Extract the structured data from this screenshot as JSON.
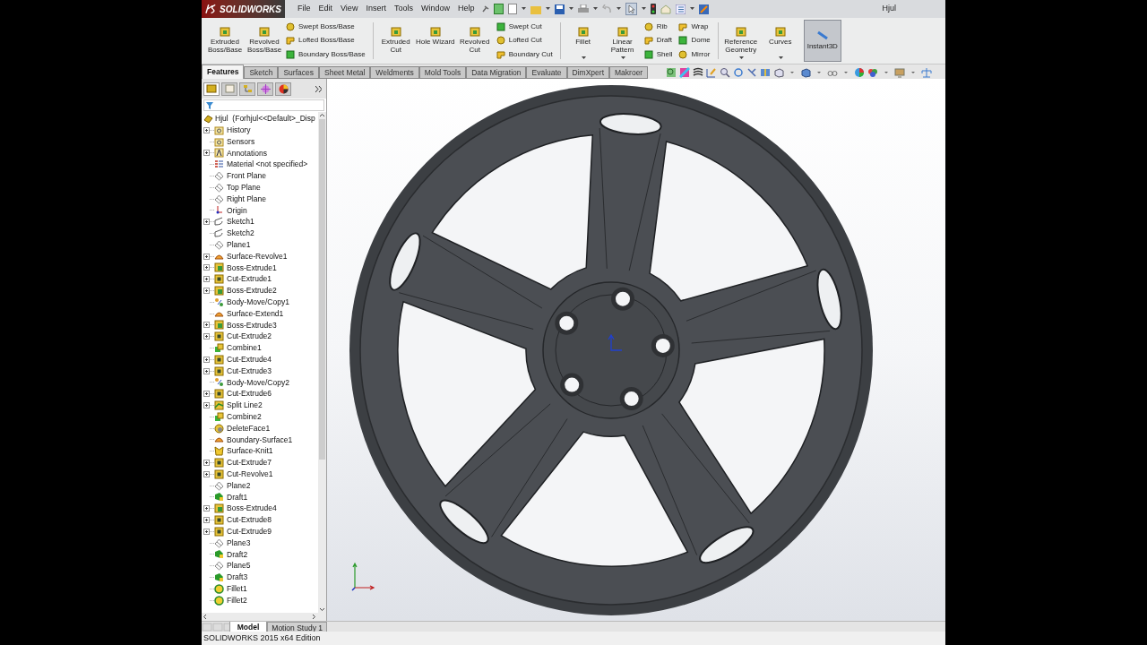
{
  "window": {
    "logo": "SOLIDWORKS",
    "title": "Hjul"
  },
  "menu": [
    "File",
    "Edit",
    "View",
    "Insert",
    "Tools",
    "Window",
    "Help"
  ],
  "ribbon": {
    "columns": [
      {
        "kind": "large",
        "label": "Extruded Boss/Base",
        "dropdown": false
      },
      {
        "kind": "large",
        "label": "Revolved Boss/Base",
        "dropdown": false
      },
      {
        "kind": "stack",
        "items": [
          "Swept Boss/Base",
          "Lofted Boss/Base",
          "Boundary Boss/Base"
        ]
      },
      {
        "kind": "separator"
      },
      {
        "kind": "large",
        "label": "Extruded Cut",
        "dropdown": false
      },
      {
        "kind": "large",
        "label": "Hole Wizard",
        "dropdown": false
      },
      {
        "kind": "large",
        "label": "Revolved Cut",
        "dropdown": false
      },
      {
        "kind": "stack",
        "items": [
          "Swept Cut",
          "Lofted Cut",
          "Boundary Cut"
        ]
      },
      {
        "kind": "separator"
      },
      {
        "kind": "large",
        "label": "Fillet",
        "dropdown": true
      },
      {
        "kind": "large",
        "label": "Linear Pattern",
        "dropdown": true
      },
      {
        "kind": "stack",
        "items": [
          "Rib",
          "Draft",
          "Shell"
        ]
      },
      {
        "kind": "stack",
        "items": [
          "Wrap",
          "Dome",
          "Mirror"
        ]
      },
      {
        "kind": "separator"
      },
      {
        "kind": "large",
        "label": "Reference Geometry",
        "dropdown": true
      },
      {
        "kind": "large",
        "label": "Curves",
        "dropdown": true
      },
      {
        "kind": "toggle",
        "label": "Instant3D",
        "selected": true
      }
    ]
  },
  "tabs": [
    {
      "label": "Features",
      "selected": true
    },
    {
      "label": "Sketch",
      "selected": false
    },
    {
      "label": "Surfaces",
      "selected": false
    },
    {
      "label": "Sheet Metal",
      "selected": false
    },
    {
      "label": "Weldments",
      "selected": false
    },
    {
      "label": "Mold Tools",
      "selected": false
    },
    {
      "label": "Data Migration",
      "selected": false
    },
    {
      "label": "Evaluate",
      "selected": false
    },
    {
      "label": "DimXpert",
      "selected": false
    },
    {
      "label": "Makroer",
      "selected": false
    }
  ],
  "tree": {
    "root": "Hjul  (Forhjul<<Default>_Disp",
    "items": [
      {
        "label": "History",
        "kind": "folder",
        "expandable": true
      },
      {
        "label": "Sensors",
        "kind": "folder",
        "expandable": false
      },
      {
        "label": "Annotations",
        "kind": "annotation",
        "expandable": true
      },
      {
        "label": "Material <not specified>",
        "kind": "material",
        "expandable": false
      },
      {
        "label": "Front Plane",
        "kind": "plane",
        "expandable": false
      },
      {
        "label": "Top Plane",
        "kind": "plane",
        "expandable": false
      },
      {
        "label": "Right Plane",
        "kind": "plane",
        "expandable": false
      },
      {
        "label": "Origin",
        "kind": "origin",
        "expandable": false
      },
      {
        "label": "Sketch1",
        "kind": "sketch",
        "expandable": true
      },
      {
        "label": "Sketch2",
        "kind": "sketch",
        "expandable": false
      },
      {
        "label": "Plane1",
        "kind": "plane",
        "expandable": false
      },
      {
        "label": "Surface-Revolve1",
        "kind": "surface",
        "expandable": true
      },
      {
        "label": "Boss-Extrude1",
        "kind": "boss",
        "expandable": true
      },
      {
        "label": "Cut-Extrude1",
        "kind": "cut",
        "expandable": true
      },
      {
        "label": "Boss-Extrude2",
        "kind": "boss",
        "expandable": true
      },
      {
        "label": "Body-Move/Copy1",
        "kind": "move",
        "expandable": false
      },
      {
        "label": "Surface-Extend1",
        "kind": "surface",
        "expandable": false
      },
      {
        "label": "Boss-Extrude3",
        "kind": "boss",
        "expandable": true
      },
      {
        "label": "Cut-Extrude2",
        "kind": "cut",
        "expandable": true
      },
      {
        "label": "Combine1",
        "kind": "combine",
        "expandable": false
      },
      {
        "label": "Cut-Extrude4",
        "kind": "cut",
        "expandable": true
      },
      {
        "label": "Cut-Extrude3",
        "kind": "cut",
        "expandable": true
      },
      {
        "label": "Body-Move/Copy2",
        "kind": "move",
        "expandable": false
      },
      {
        "label": "Cut-Extrude6",
        "kind": "cut",
        "expandable": true
      },
      {
        "label": "Split Line2",
        "kind": "split",
        "expandable": true
      },
      {
        "label": "Combine2",
        "kind": "combine",
        "expandable": false
      },
      {
        "label": "DeleteFace1",
        "kind": "delete",
        "expandable": false
      },
      {
        "label": "Boundary-Surface1",
        "kind": "surface",
        "expandable": false
      },
      {
        "label": "Surface-Knit1",
        "kind": "knit",
        "expandable": false
      },
      {
        "label": "Cut-Extrude7",
        "kind": "cut",
        "expandable": true
      },
      {
        "label": "Cut-Revolve1",
        "kind": "cut",
        "expandable": true
      },
      {
        "label": "Plane2",
        "kind": "plane",
        "expandable": false
      },
      {
        "label": "Draft1",
        "kind": "draft",
        "expandable": false
      },
      {
        "label": "Boss-Extrude4",
        "kind": "boss",
        "expandable": true
      },
      {
        "label": "Cut-Extrude8",
        "kind": "cut",
        "expandable": true
      },
      {
        "label": "Cut-Extrude9",
        "kind": "cut",
        "expandable": true
      },
      {
        "label": "Plane3",
        "kind": "plane",
        "expandable": false
      },
      {
        "label": "Draft2",
        "kind": "draft",
        "expandable": false
      },
      {
        "label": "Plane5",
        "kind": "plane",
        "expandable": false
      },
      {
        "label": "Draft3",
        "kind": "draft",
        "expandable": false
      },
      {
        "label": "Fillet1",
        "kind": "fillet",
        "expandable": false
      },
      {
        "label": "Fillet2",
        "kind": "fillet",
        "expandable": false
      }
    ]
  },
  "bottom_tabs": [
    {
      "label": "Model",
      "selected": true
    },
    {
      "label": "Motion Study 1",
      "selected": false
    }
  ],
  "status_bar": "SOLIDWORKS 2015 x64 Edition"
}
